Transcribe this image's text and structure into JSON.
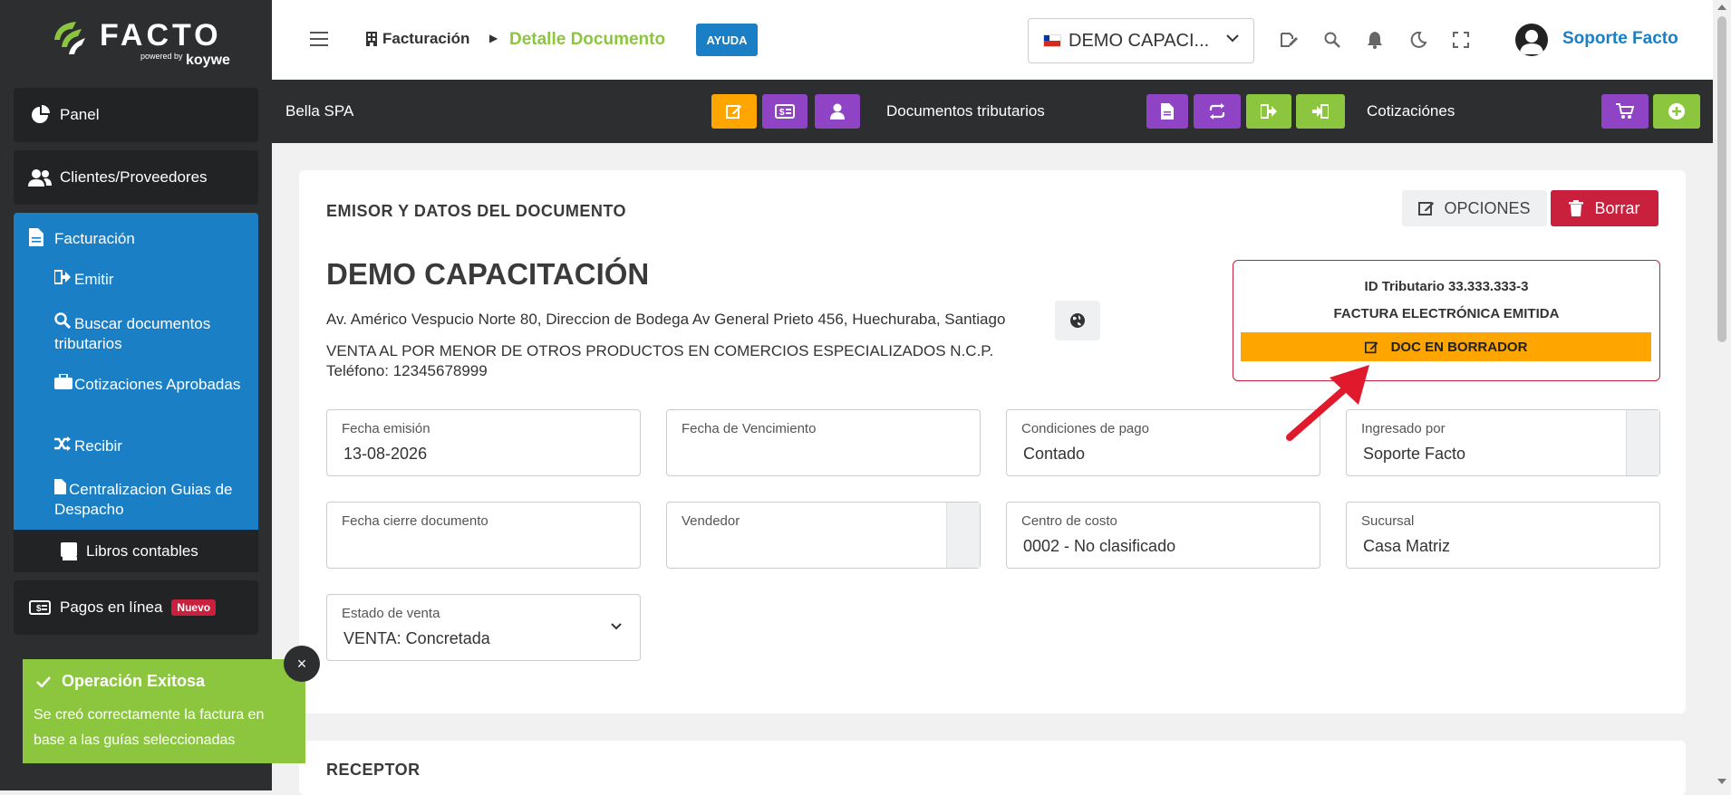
{
  "sidebar": {
    "logo": {
      "word": "FACTO",
      "powered": "powered by",
      "brand": "koywe"
    },
    "panel": "Panel",
    "clientes": "Clientes/Proveedores",
    "facturacion": {
      "label": "Facturación",
      "items": [
        "Emitir",
        "Buscar documentos tributarios",
        "Cotizaciones Aprobadas",
        "Recibir",
        "Centralizacion Guias de Despacho"
      ]
    },
    "libros": "Libros contables",
    "pagos": "Pagos en línea",
    "pagos_badge": "Nuevo"
  },
  "header": {
    "crumb_section": "Facturación",
    "crumb_page": "Detalle Documento",
    "help": "AYUDA",
    "company_select": "DEMO CAPACI...",
    "user_name": "Soporte Facto"
  },
  "actionbar": {
    "client": "Bella SPA",
    "docs_label": "Documentos tributarios",
    "quotes_label": "Cotizaciónes"
  },
  "document": {
    "section_title": "EMISOR Y DATOS DEL DOCUMENTO",
    "options_label": "OPCIONES",
    "delete_label": "Borrar",
    "company": "DEMO CAPACITACIÓN",
    "address": "Av. Américo Vespucio Norte 80, Direccion de Bodega Av General Prieto 456, Huechuraba, Santiago",
    "giro": "VENTA AL POR MENOR DE OTROS PRODUCTOS EN COMERCIOS ESPECIALIZADOS N.C.P.",
    "phone": "Teléfono: 12345678999",
    "tax_id": "ID Tributario 33.333.333-3",
    "doc_type": "FACTURA ELECTRÓNICA EMITIDA",
    "doc_status": "DOC EN BORRADOR",
    "fields": {
      "fecha_emision": {
        "label": "Fecha emisión",
        "value": "13-08-2026"
      },
      "fecha_vencimiento": {
        "label": "Fecha de Vencimiento",
        "value": ""
      },
      "condiciones": {
        "label": "Condiciones de pago",
        "value": "Contado"
      },
      "ingresado": {
        "label": "Ingresado por",
        "value": "Soporte Facto"
      },
      "fecha_cierre": {
        "label": "Fecha cierre documento",
        "value": ""
      },
      "vendedor": {
        "label": "Vendedor",
        "value": ""
      },
      "centro_costo": {
        "label": "Centro de costo",
        "value": "0002 - No clasificado"
      },
      "sucursal": {
        "label": "Sucursal",
        "value": "Casa Matriz"
      },
      "estado_venta": {
        "label": "Estado de venta",
        "value": "VENTA: Concretada"
      }
    }
  },
  "receptor": {
    "title": "RECEPTOR"
  },
  "toast": {
    "title": "Operación Exitosa",
    "message": "Se creó correctamente la factura en base a las guías seleccionadas",
    "close": "×"
  },
  "colors": {
    "blue": "#1b7fc6",
    "green": "#8cc63f",
    "orange": "#ffa500",
    "purple": "#8e44c4",
    "red": "#c8203d",
    "dark": "#2d2e30"
  }
}
